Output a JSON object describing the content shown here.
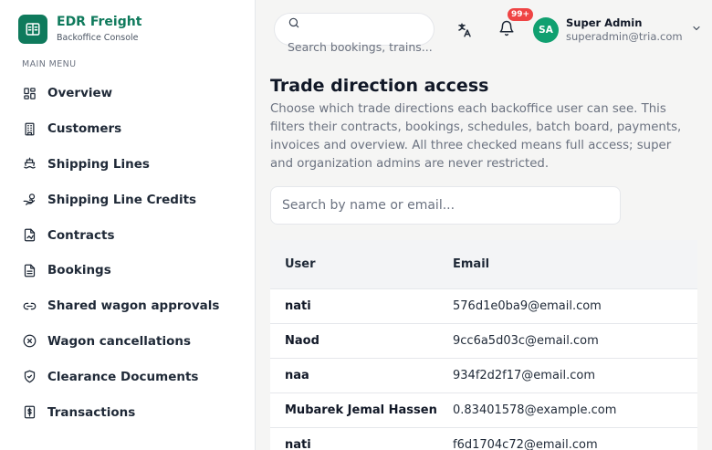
{
  "brand": {
    "name": "EDR Freight",
    "subtitle": "Backoffice Console",
    "color": "#0f7a5c"
  },
  "sidebar": {
    "heading": "MAIN MENU",
    "items": [
      {
        "label": "Overview",
        "icon": "grid-icon"
      },
      {
        "label": "Customers",
        "icon": "building-icon"
      },
      {
        "label": "Shipping Lines",
        "icon": "ship-icon"
      },
      {
        "label": "Shipping Line Credits",
        "icon": "hand-coins-icon"
      },
      {
        "label": "Contracts",
        "icon": "file-signature-icon"
      },
      {
        "label": "Bookings",
        "icon": "document-icon"
      },
      {
        "label": "Shared wagon approvals",
        "icon": "link-icon"
      },
      {
        "label": "Wagon cancellations",
        "icon": "x-circle-icon"
      },
      {
        "label": "Clearance Documents",
        "icon": "shield-check-icon"
      },
      {
        "label": "Transactions",
        "icon": "dollar-receipt-icon"
      }
    ]
  },
  "topbar": {
    "search_placeholder": "Search bookings, trains...",
    "notification_badge": "99+",
    "user": {
      "initials": "SA",
      "name": "Super Admin",
      "email": "superadmin@tria.com"
    }
  },
  "page": {
    "title": "Trade direction access",
    "description": "Choose which trade directions each backoffice user can see. This filters their contracts, bookings, schedules, batch board, payments, invoices and overview. All three checked means full access; super and organization admins are never restricted.",
    "filter_placeholder": "Search by name or email..."
  },
  "table": {
    "headers": {
      "user": "User",
      "email": "Email"
    },
    "rows": [
      {
        "user": "nati",
        "email": "576d1e0ba9@email.com"
      },
      {
        "user": "Naod",
        "email": "9cc6a5d03c@email.com"
      },
      {
        "user": "naa",
        "email": "934f2d2f17@email.com"
      },
      {
        "user": "Mubarek Jemal Hassen",
        "email": "0.83401578@example.com"
      },
      {
        "user": "nati",
        "email": "f6d1704c72@email.com"
      }
    ]
  },
  "colors": {
    "accent": "#0f7a5c",
    "avatar": "#10a070",
    "badge": "#ef4444"
  }
}
